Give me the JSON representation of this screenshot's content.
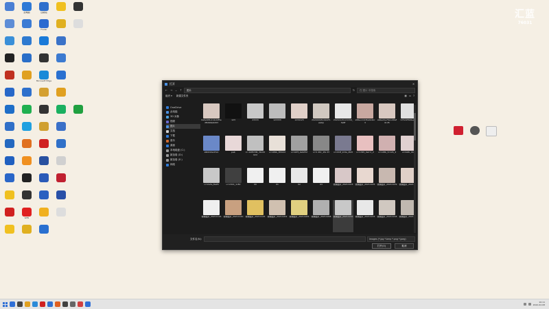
{
  "desktop": {
    "background": "#f5efe4",
    "icons": [
      {
        "label": "",
        "color": "#4a7fd4"
      },
      {
        "label": "此电脑",
        "color": "#2e79d6"
      },
      {
        "label": "回收站",
        "color": "#2f6fcc"
      },
      {
        "label": "",
        "color": "#f0c020"
      },
      {
        "label": "",
        "color": "#333333"
      },
      {
        "label": "",
        "color": "#5e8dd6"
      },
      {
        "label": "",
        "color": "#3b7bd4"
      },
      {
        "label": "Finder",
        "color": "#2b6ad0"
      },
      {
        "label": "",
        "color": "#e0b020"
      },
      {
        "label": "",
        "color": "#dddddd"
      },
      {
        "label": "",
        "color": "#3a8fd8"
      },
      {
        "label": "",
        "color": "#2e7ad0"
      },
      {
        "label": "",
        "color": "#1a7ad8"
      },
      {
        "label": "",
        "color": "#3a72c8"
      },
      {
        "label": "",
        "color": "#f5efe4"
      },
      {
        "label": "",
        "color": "#222222"
      },
      {
        "label": "",
        "color": "#2a6ec8"
      },
      {
        "label": "",
        "color": "#333333"
      },
      {
        "label": "",
        "color": "#3c7ad0"
      },
      {
        "label": "",
        "color": "#f5efe4"
      },
      {
        "label": "",
        "color": "#c03020"
      },
      {
        "label": "",
        "color": "#e0a020"
      },
      {
        "label": "Microsoft Edge",
        "color": "#1a8ad8"
      },
      {
        "label": "",
        "color": "#2a70d0"
      },
      {
        "label": "",
        "color": "#f5efe4"
      },
      {
        "label": "",
        "color": "#2868c8"
      },
      {
        "label": "",
        "color": "#2e70cc"
      },
      {
        "label": "",
        "color": "#d4a030"
      },
      {
        "label": "",
        "color": "#e0a020"
      },
      {
        "label": "",
        "color": "#f5efe4"
      },
      {
        "label": "",
        "color": "#1e6ec8"
      },
      {
        "label": "",
        "color": "#20b050"
      },
      {
        "label": "",
        "color": "#333333"
      },
      {
        "label": "",
        "color": "#1ab060"
      },
      {
        "label": "",
        "color": "#20a040"
      },
      {
        "label": "",
        "color": "#3070c8"
      },
      {
        "label": "",
        "color": "#20a0e0"
      },
      {
        "label": "",
        "color": "#d0a030"
      },
      {
        "label": "",
        "color": "#3a70c8"
      },
      {
        "label": "",
        "color": "#f5efe4"
      },
      {
        "label": "",
        "color": "#2468c0"
      },
      {
        "label": "",
        "color": "#e07020"
      },
      {
        "label": "",
        "color": "#d02020"
      },
      {
        "label": "",
        "color": "#3070c8"
      },
      {
        "label": "",
        "color": "#f5efe4"
      },
      {
        "label": "",
        "color": "#2060c0"
      },
      {
        "label": "",
        "color": "#f09020"
      },
      {
        "label": "",
        "color": "#2850a0"
      },
      {
        "label": "",
        "color": "#d0d0d0"
      },
      {
        "label": "",
        "color": "#f5efe4"
      },
      {
        "label": "",
        "color": "#2a66c8"
      },
      {
        "label": "",
        "color": "#222222"
      },
      {
        "label": "",
        "color": "#2a5ab8"
      },
      {
        "label": "",
        "color": "#c02030"
      },
      {
        "label": "",
        "color": "#f5efe4"
      },
      {
        "label": "",
        "color": "#f0c020"
      },
      {
        "label": "",
        "color": "#333333"
      },
      {
        "label": "",
        "color": "#2a60c0"
      },
      {
        "label": "",
        "color": "#2850a8"
      },
      {
        "label": "",
        "color": "#f5efe4"
      },
      {
        "label": "",
        "color": "#d02020"
      },
      {
        "label": "WPS",
        "color": "#e02020"
      },
      {
        "label": "",
        "color": "#f0b020"
      },
      {
        "label": "",
        "color": "#dddddd"
      },
      {
        "label": "",
        "color": "#f5efe4"
      },
      {
        "label": "",
        "color": "#f0c020"
      },
      {
        "label": "",
        "color": "#e0b020"
      },
      {
        "label": "",
        "color": "#2a70d0"
      }
    ],
    "watermark": {
      "logo": "汇蓝",
      "id": "76031"
    },
    "side_icons": [
      {
        "label": "",
        "color": "#d02030"
      },
      {
        "label": "",
        "color": "#555555"
      },
      {
        "label": "",
        "color": "#eeeeee"
      }
    ]
  },
  "dialog": {
    "title": "打开",
    "address": "图片",
    "search_placeholder": "在 图片 中搜索",
    "toolbar": {
      "organize": "组织 ▾",
      "new_folder": "新建文件夹"
    },
    "sidebar": [
      {
        "label": "OneDrive",
        "color": "#2f7ad6",
        "sel": false
      },
      {
        "label": "此电脑",
        "color": "#4a90e2",
        "sel": false
      },
      {
        "label": "3D 对象",
        "color": "#4aa0e0",
        "sel": false
      },
      {
        "label": "视频",
        "color": "#6a6ad0",
        "sel": false
      },
      {
        "label": "图片",
        "color": "#4a90e2",
        "sel": true
      },
      {
        "label": "文档",
        "color": "#d0d0d0",
        "sel": false
      },
      {
        "label": "下载",
        "color": "#2f7ad6",
        "sel": false
      },
      {
        "label": "音乐",
        "color": "#d06a30",
        "sel": false
      },
      {
        "label": "桌面",
        "color": "#2f7ad6",
        "sel": false
      },
      {
        "label": "本地磁盘 (C:)",
        "color": "#999999",
        "sel": false
      },
      {
        "label": "新加卷 (D:)",
        "color": "#999999",
        "sel": false
      },
      {
        "label": "新加卷 (E:)",
        "color": "#999999",
        "sel": false
      },
      {
        "label": "网络",
        "color": "#2f7ad6",
        "sel": false
      }
    ],
    "files": [
      {
        "name": "0efad9f12c1bd4f5edfb6b6e9d63",
        "color": "#d8c8c0",
        "sel": false
      },
      {
        "name": "123",
        "color": "#111111",
        "sel": false
      },
      {
        "name": "23333",
        "color": "#c8c8c8",
        "sel": false
      },
      {
        "name": "123333",
        "color": "#bcbcbc",
        "sel": false
      },
      {
        "name": "1234123",
        "color": "#e0d0c8",
        "sel": false
      },
      {
        "name": "20200918144225.webp",
        "color": "#d0c8c0",
        "sel": false
      },
      {
        "name": "20210125115339_3e8f",
        "color": "#e8e8e8",
        "sel": false
      },
      {
        "name": "a56ec2c03fe0b4bc3",
        "color": "#c8a8a0",
        "sel": false
      },
      {
        "name": "a64ed2e7fa1cd6af6cd5",
        "color": "#d8c8c0",
        "sel": false
      },
      {
        "name": "b75d4f5b8e20cf",
        "color": "#e0e0e0",
        "sel": false
      },
      {
        "name": "a9b04ded7e1",
        "color": "#6a88c8",
        "sel": false
      },
      {
        "name": "pab",
        "color": "#e8d8d8",
        "sel": false
      },
      {
        "name": "cc-1b8fcfd6_3bcdd02d",
        "color": "#c0c0c0",
        "sel": false
      },
      {
        "name": "u=189b_3fd02d",
        "color": "#e8e0d8",
        "sel": false
      },
      {
        "name": "u=1bf3_4a9d52",
        "color": "#a0a0a0",
        "sel": false
      },
      {
        "name": "u=1 26c_1fe 23",
        "color": "#888888",
        "sel": false
      },
      {
        "name": "u=2d4f_2c0e_4fa5",
        "color": "#7a7a90",
        "sel": false
      },
      {
        "name": "u=1345_9ed 2_2",
        "color": "#e8c0c0",
        "sel": false
      },
      {
        "name": "u=128b_3c12b_4",
        "color": "#d0b0b0",
        "sel": false
      },
      {
        "name": "u=2a8c_0b9c",
        "color": "#e0d0d0",
        "sel": false
      },
      {
        "name": "u=2e3a_8e26",
        "color": "#c8c8c8",
        "sel": false
      },
      {
        "name": "u=2d14_1c8d",
        "color": "#404040",
        "sel": false
      },
      {
        "name": "00",
        "color": "#f0f0f0",
        "sel": false
      },
      {
        "name": "01",
        "color": "#f0f0f0",
        "sel": false
      },
      {
        "name": "02",
        "color": "#e8e8e8",
        "sel": false
      },
      {
        "name": "03",
        "color": "#f0f0f0",
        "sel": false
      },
      {
        "name": "微信图片_20211103",
        "color": "#d8c8c8",
        "sel": false
      },
      {
        "name": "微信图片_20211105",
        "color": "#e8d8d0",
        "sel": false
      },
      {
        "name": "微信图片_20211109",
        "color": "#c8b8b0",
        "sel": false
      },
      {
        "name": "微信图片_20211112",
        "color": "#e0d0c8",
        "sel": false
      },
      {
        "name": "微信图片_20211116",
        "color": "#f0f0f0",
        "sel": false
      },
      {
        "name": "微信图片_20211120",
        "color": "#c8a080",
        "sel": false
      },
      {
        "name": "微信图片_20211125",
        "color": "#e0c060",
        "sel": false
      },
      {
        "name": "微信图片_20211202",
        "color": "#d0c0b0",
        "sel": false
      },
      {
        "name": "微信图片_20211205",
        "color": "#e0d080",
        "sel": false
      },
      {
        "name": "微信图片_20211208",
        "color": "#b0b0b0",
        "sel": false
      },
      {
        "name": "微信图片_20211210",
        "color": "#c8c8c8",
        "sel": true
      },
      {
        "name": "微信图片_20211215",
        "color": "#e8e8e8",
        "sel": false
      },
      {
        "name": "微信图片_20211218",
        "color": "#d0c8c0",
        "sel": false
      },
      {
        "name": "微信图片_20211220",
        "color": "#c0b8b0",
        "sel": false
      }
    ],
    "footer": {
      "filename_label": "文件名(N):",
      "filter": "Images (*.jpg *.bmp *.png *.jpeg)",
      "open": "打开(O)",
      "cancel": "取消"
    }
  },
  "taskbar": {
    "icons": [
      "#2f6fd6",
      "#444444",
      "#e0a020",
      "#2a8ad8",
      "#d02020",
      "#3070d0",
      "#e06020",
      "#404040",
      "#666666",
      "#d04040",
      "#2f6fd6"
    ],
    "time": "10:11",
    "date": "2022-02-08"
  }
}
